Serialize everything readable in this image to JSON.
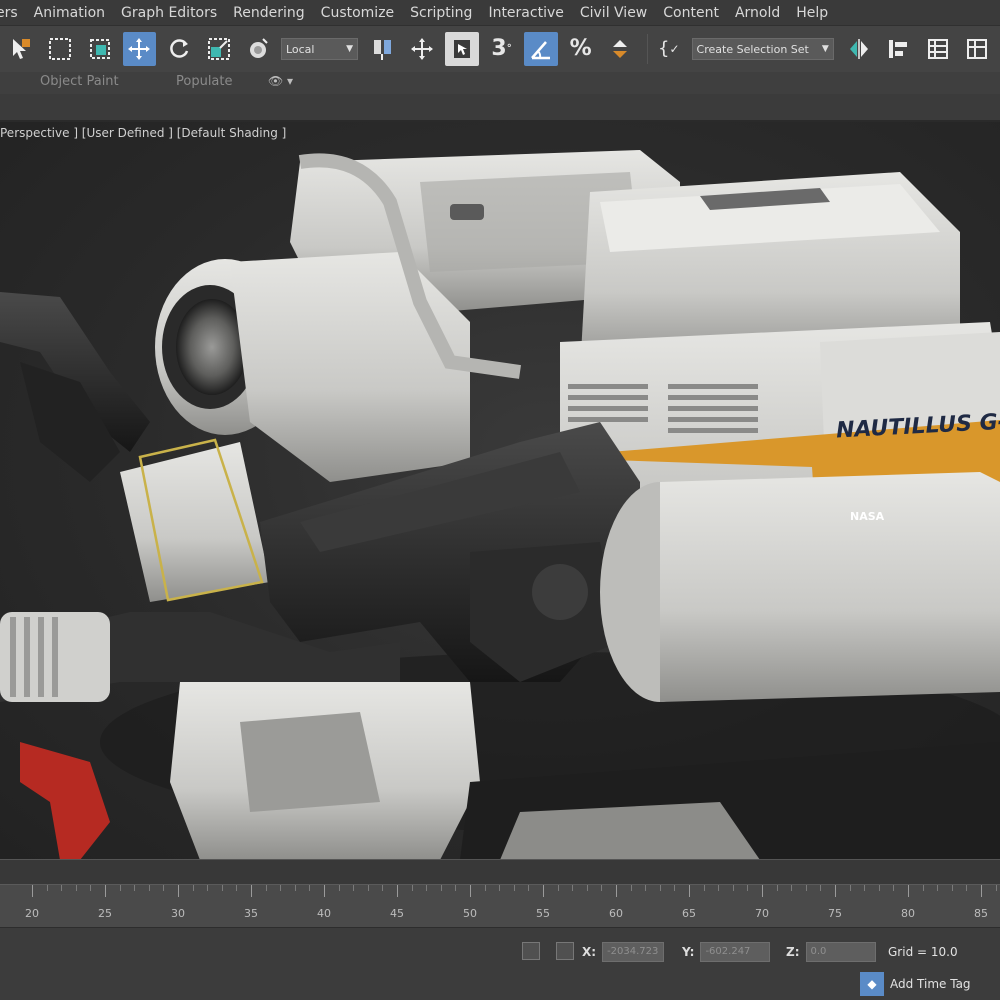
{
  "menu": [
    "ers",
    "Animation",
    "Graph Editors",
    "Rendering",
    "Customize",
    "Scripting",
    "Interactive",
    "Civil View",
    "Content",
    "Arnold",
    "Help"
  ],
  "toolbar": {
    "coord_system": "Local",
    "selection_set": "Create Selection Set",
    "icons": [
      "select-object-icon",
      "select-region-icon",
      "window-crossing-icon",
      "move-icon",
      "rotate-icon",
      "scale-icon",
      "placement-icon",
      "pivot-icon",
      "select-manipulate-icon",
      "keyboard-shortcut-icon",
      "snap-3d-icon",
      "angle-snap-icon",
      "percent-snap-icon",
      "spinner-snap-icon",
      "named-selection-icon",
      "mirror-icon",
      "align-icon",
      "layer-explorer-icon"
    ]
  },
  "ribbon": {
    "object_paint": "Object Paint",
    "populate": "Populate",
    "eye_toggle": "👁 ▾"
  },
  "viewport": {
    "label": "Perspective ] [User Defined ] [Default Shading ]",
    "model_text": {
      "brand": "NAUTILLUS G-",
      "agency": "NASA"
    }
  },
  "timeline": {
    "ticks": [
      "20",
      "25",
      "30",
      "35",
      "40",
      "45",
      "50",
      "55",
      "60",
      "65",
      "70",
      "75",
      "80",
      "85"
    ]
  },
  "status": {
    "x_label": "X:",
    "x_value": "-2034.723",
    "y_label": "Y:",
    "y_value": "-602.247",
    "z_label": "Z:",
    "z_value": "0.0",
    "grid": "Grid = 10.0",
    "add_time_tag": "Add Time Tag"
  },
  "colors": {
    "accent_blue": "#5a8bc7",
    "hull_white": "#d6d6d4",
    "stripe_orange": "#d9972b",
    "selection_yellow": "#c9b24a",
    "nasa_blue": "#1f4fa6"
  }
}
